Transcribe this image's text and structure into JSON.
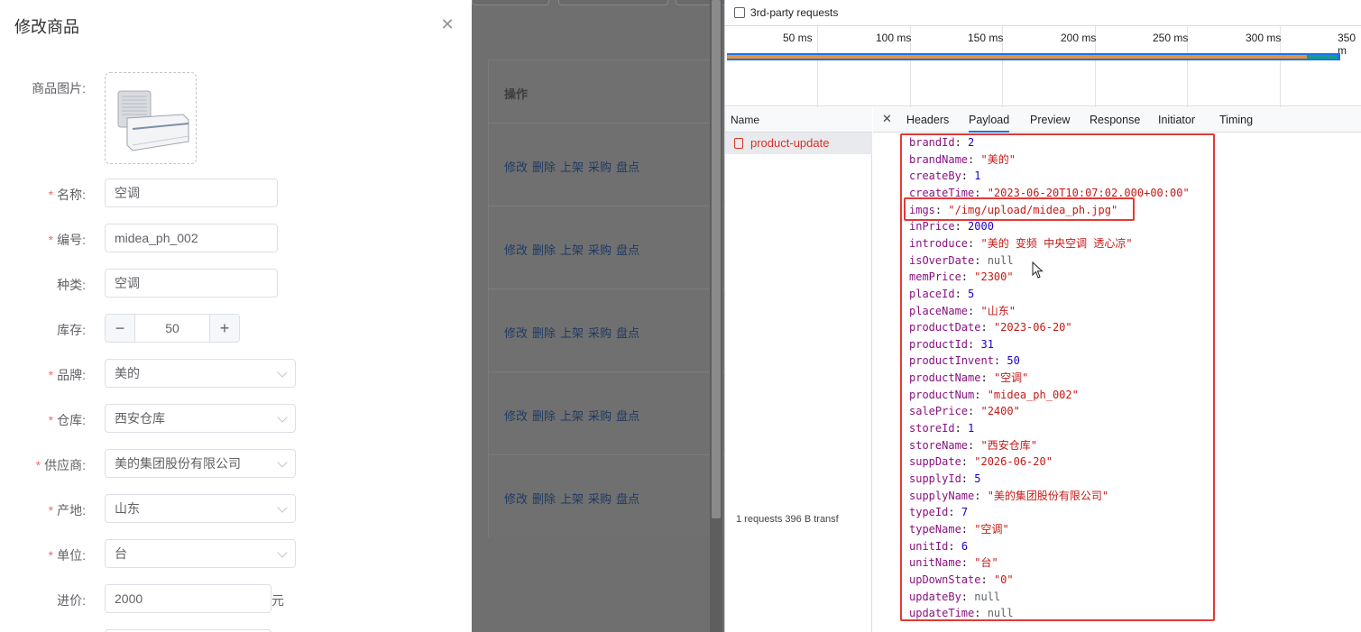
{
  "drawer": {
    "title": "修改商品",
    "close_icon": "close-icon",
    "image_label": "商品图片:",
    "fields": [
      {
        "label": "名称:",
        "required": "*",
        "kind": "input",
        "value": "空调"
      },
      {
        "label": "编号:",
        "required": "*",
        "kind": "input",
        "value": "midea_ph_002"
      },
      {
        "label": "种类:",
        "required": "",
        "kind": "input",
        "value": "空调"
      },
      {
        "label": "库存:",
        "required": "",
        "kind": "stepper",
        "value": "50",
        "minus": "−",
        "plus": "+"
      },
      {
        "label": "品牌:",
        "required": "*",
        "kind": "select",
        "value": "美的"
      },
      {
        "label": "仓库:",
        "required": "*",
        "kind": "select",
        "value": "西安仓库"
      },
      {
        "label": "供应商:",
        "required": "*",
        "kind": "select",
        "value": "美的集团股份有限公司"
      },
      {
        "label": "产地:",
        "required": "*",
        "kind": "select",
        "value": "山东"
      },
      {
        "label": "单位:",
        "required": "*",
        "kind": "select",
        "value": "台"
      },
      {
        "label": "进价:",
        "required": "",
        "kind": "input",
        "value": "2000",
        "suffix": "元"
      }
    ]
  },
  "table": {
    "ops_header": "操作",
    "row_actions": [
      "修改",
      "删除",
      "上架",
      "采购",
      "盘点"
    ],
    "row_count": 5
  },
  "devtools": {
    "third_party_label": "3rd-party requests",
    "ticks": [
      "50 ms",
      "100 ms",
      "150 ms",
      "200 ms",
      "250 ms",
      "300 ms",
      "350 m"
    ],
    "name_header": "Name",
    "request_name": "product-update",
    "footer": "1 requests    396 B transf",
    "tabs": [
      "Headers",
      "Payload",
      "Preview",
      "Response",
      "Initiator",
      "Timing"
    ],
    "active_tab": "Payload",
    "payload": [
      {
        "key": "brandId",
        "value": "2",
        "type": "num"
      },
      {
        "key": "brandName",
        "value": "\"美的\"",
        "type": "str"
      },
      {
        "key": "createBy",
        "value": "1",
        "type": "num"
      },
      {
        "key": "createTime",
        "value": "\"2023-06-20T10:07:02.000+00:00\"",
        "type": "str"
      },
      {
        "key": "imgs",
        "value": "\"/img/upload/midea_ph.jpg\"",
        "type": "str"
      },
      {
        "key": "inPrice",
        "value": "2000",
        "type": "num"
      },
      {
        "key": "introduce",
        "value": "\"美的 变频  中央空调 透心凉\"",
        "type": "str"
      },
      {
        "key": "isOverDate",
        "value": "null",
        "type": "null"
      },
      {
        "key": "memPrice",
        "value": "\"2300\"",
        "type": "str"
      },
      {
        "key": "placeId",
        "value": "5",
        "type": "num"
      },
      {
        "key": "placeName",
        "value": "\"山东\"",
        "type": "str"
      },
      {
        "key": "productDate",
        "value": "\"2023-06-20\"",
        "type": "str"
      },
      {
        "key": "productId",
        "value": "31",
        "type": "num"
      },
      {
        "key": "productInvent",
        "value": "50",
        "type": "num"
      },
      {
        "key": "productName",
        "value": "\"空调\"",
        "type": "str"
      },
      {
        "key": "productNum",
        "value": "\"midea_ph_002\"",
        "type": "str"
      },
      {
        "key": "salePrice",
        "value": "\"2400\"",
        "type": "str"
      },
      {
        "key": "storeId",
        "value": "1",
        "type": "num"
      },
      {
        "key": "storeName",
        "value": "\"西安仓库\"",
        "type": "str"
      },
      {
        "key": "suppDate",
        "value": "\"2026-06-20\"",
        "type": "str"
      },
      {
        "key": "supplyId",
        "value": "5",
        "type": "num"
      },
      {
        "key": "supplyName",
        "value": "\"美的集团股份有限公司\"",
        "type": "str"
      },
      {
        "key": "typeId",
        "value": "7",
        "type": "num"
      },
      {
        "key": "typeName",
        "value": "\"空调\"",
        "type": "str"
      },
      {
        "key": "unitId",
        "value": "6",
        "type": "num"
      },
      {
        "key": "unitName",
        "value": "\"台\"",
        "type": "str"
      },
      {
        "key": "upDownState",
        "value": "\"0\"",
        "type": "str"
      },
      {
        "key": "updateBy",
        "value": "null",
        "type": "null"
      },
      {
        "key": "updateTime",
        "value": "null",
        "type": "null"
      }
    ]
  },
  "colors": {
    "required": "#f56c6c",
    "link_masked": "#1f3a63",
    "highlight_frame": "#e53935",
    "devtools_accent": "#1a73e8",
    "request_error": "#d93025"
  }
}
